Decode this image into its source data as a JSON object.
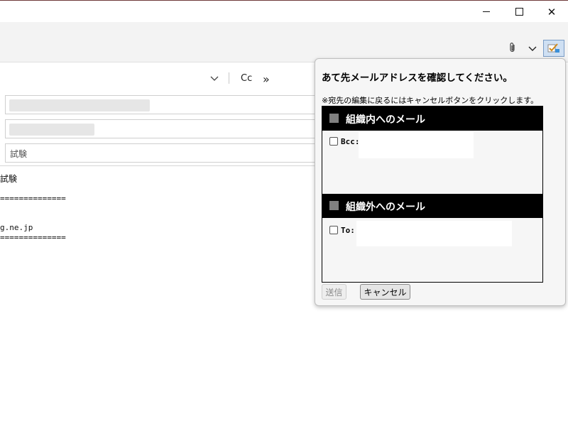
{
  "window": {
    "minimize_icon": "minimize-icon",
    "maximize_icon": "maximize-icon",
    "close_glyph": "✕"
  },
  "ribbon": {
    "attach_glyph": "📎",
    "addin_icon": "addin-check-icon"
  },
  "compose": {
    "cc_label": "Cc",
    "more_glyph": "»",
    "subject_value": "試験",
    "body_lines": [
      "試験",
      "==============",
      "g.ne.jp",
      "=============="
    ]
  },
  "dialog": {
    "title": "あて先メールアドレスを確認してください。",
    "note": "※宛先の編集に戻るにはキャンセルボタンをクリックします。",
    "sections": [
      {
        "heading": "組織内へのメール",
        "recipients": [
          {
            "label": "Bcc:",
            "checked": false
          }
        ]
      },
      {
        "heading": "組織外へのメール",
        "recipients": [
          {
            "label": "To:",
            "checked": false
          }
        ]
      }
    ],
    "send_label": "送信",
    "cancel_label": "キャンセル"
  },
  "colors": {
    "section_header_bg": "#000000",
    "dialog_bg": "#f6f6f6",
    "ribbon_bg": "#f3f3f3"
  }
}
